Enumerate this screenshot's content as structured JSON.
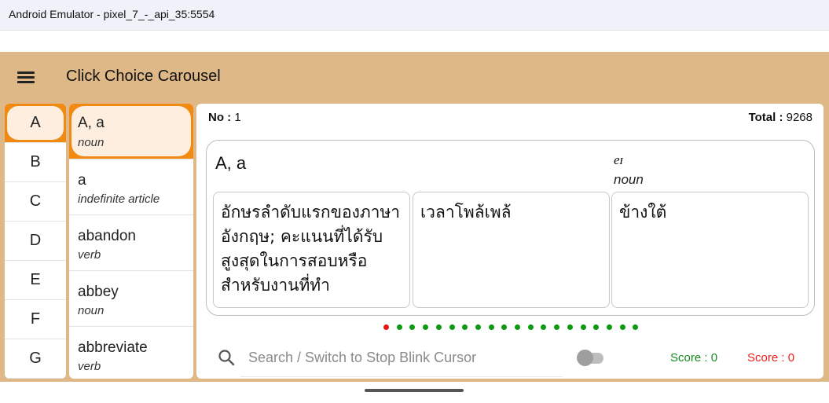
{
  "window": {
    "title": "Android Emulator - pixel_7_-_api_35:5554"
  },
  "app": {
    "title": "Click Choice Carousel",
    "menu_icon": "hamburger-menu-icon",
    "background_color": "#deb887",
    "accent_color": "#f08a12"
  },
  "letters": [
    "A",
    "B",
    "C",
    "D",
    "E",
    "F",
    "G"
  ],
  "words": [
    {
      "word": "A, a",
      "pos": "noun"
    },
    {
      "word": "a",
      "pos": "indefinite article"
    },
    {
      "word": "abandon",
      "pos": "verb"
    },
    {
      "word": "abbey",
      "pos": "noun"
    },
    {
      "word": "abbreviate",
      "pos": "verb"
    }
  ],
  "main": {
    "no_label": "No :",
    "no_value": "1",
    "total_label": "Total :",
    "total_value": "9268"
  },
  "card": {
    "word": "A, a",
    "ipa": "eɪ",
    "pos": "noun",
    "choices": [
      "อักษรลำดับแรกของภาษาอังกฤษ; คะแนนที่ได้รับสูงสุดในการสอบหรือสำหรับงานที่ทำ",
      "เวลาโพล้เพล้",
      "ข้างใต้"
    ]
  },
  "carousel": {
    "total_dots": 20,
    "active_index": 0,
    "active_color": "#e8161b",
    "inactive_color": "#0d9a12"
  },
  "search": {
    "placeholder": "Search / Switch to Stop Blink Cursor",
    "value": "",
    "icon": "search-icon"
  },
  "toggle": {
    "on": false
  },
  "scores": {
    "correct_label": "Score :",
    "correct_value": "0",
    "wrong_label": "Score :",
    "wrong_value": "0",
    "correct_color": "#138a1f",
    "wrong_color": "#ef1c1c"
  }
}
